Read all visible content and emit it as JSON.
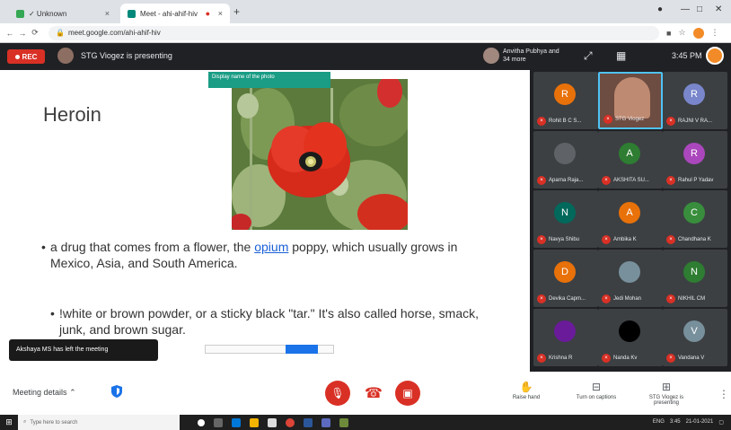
{
  "browser": {
    "tabs": [
      {
        "label": "✓ Unknown",
        "active": false
      },
      {
        "label": "Meet - ahi-ahif-hiv",
        "active": true
      }
    ],
    "url": "meet.google.com/ahi-ahif-hiv"
  },
  "meet": {
    "recording_label": "REC",
    "presenting_text": "STG Viogez is presenting",
    "host_text": "Anvitha Pubhya and 34 more",
    "time": "3:45 PM"
  },
  "slide": {
    "title": "Heroin",
    "photo_label": "Display name of the photo",
    "bullet1_pre": "a drug that comes from a flower, the ",
    "bullet1_link": "opium",
    "bullet1_post": " poppy, which usually grows in Mexico, Asia, and South America.",
    "bullet2": "!white or brown powder, or a sticky black \"tar.\" It's also called horse, smack, junk, and brown sugar."
  },
  "toast": "Akshaya MS has left the meeting",
  "participants": [
    {
      "initial": "R",
      "name": "Rohit B C S...",
      "color": "#e8710a"
    },
    {
      "initial": "",
      "name": "STG Viogez",
      "color": "#8d6e63",
      "video": true
    },
    {
      "initial": "R",
      "name": "RAJNI V RA...",
      "color": "#7986cb"
    },
    {
      "initial": "",
      "name": "Aparna Raja...",
      "color": "#5f6368",
      "image": true
    },
    {
      "initial": "A",
      "name": "AKSHITA SU...",
      "color": "#2e7d32"
    },
    {
      "initial": "R",
      "name": "Rahul P Yadav",
      "color": "#ab47bc"
    },
    {
      "initial": "N",
      "name": "Navya Shibu",
      "color": "#00695c"
    },
    {
      "initial": "A",
      "name": "Ambika K",
      "color": "#e8710a"
    },
    {
      "initial": "C",
      "name": "Chandhana K",
      "color": "#388e3c"
    },
    {
      "initial": "D",
      "name": "Devika Capm...",
      "color": "#e8710a"
    },
    {
      "initial": "",
      "name": "Jedi Mohan",
      "color": "#78909c",
      "image": true
    },
    {
      "initial": "N",
      "name": "NIKHIL CM",
      "color": "#2e7d32"
    },
    {
      "initial": "",
      "name": "Krishna R",
      "color": "#6a1b9a",
      "image": true
    },
    {
      "initial": "",
      "name": "Nanda Kv",
      "color": "#000000"
    },
    {
      "initial": "V",
      "name": "Vandana V",
      "color": "#78909c"
    }
  ],
  "controls": {
    "meeting_details": "Meeting details",
    "raise_hand": "Raise hand",
    "captions": "Turn on captions",
    "presenting": "STG Viogez is presenting"
  },
  "taskbar": {
    "search_placeholder": "Type here to search",
    "tray_time": "3:45",
    "tray_date": "21-01-2021",
    "lang": "ENG"
  }
}
